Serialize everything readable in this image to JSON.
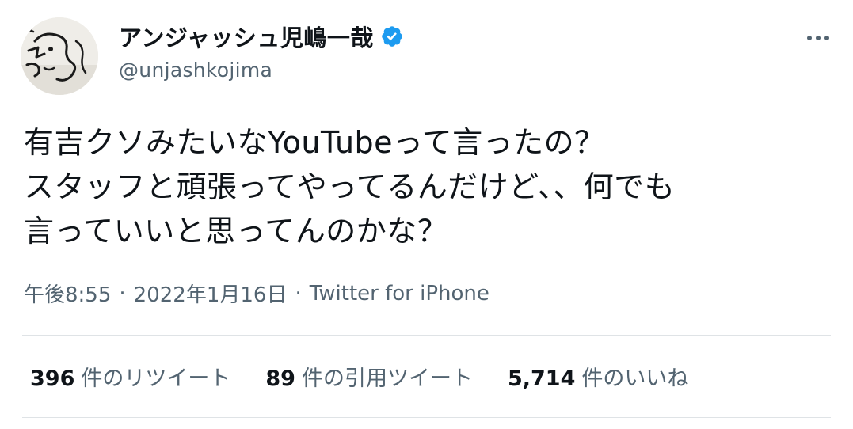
{
  "author": {
    "display_name": "アンジャッシュ児嶋一哉",
    "username": "@unjashkojima",
    "verified": true,
    "avatar_icon": "sketch-face-avatar"
  },
  "tweet": {
    "lines": [
      "有吉クソみたいなYouTubeって言ったの？",
      "スタッフと頑張ってやってるんだけど、、何でも",
      "言っていいと思ってんのかな？"
    ],
    "time": "午後8:55",
    "date": "2022年1月16日",
    "separator": "·",
    "source": "Twitter for iPhone"
  },
  "stats": {
    "retweets_count": "396",
    "retweets_label": "件のリツイート",
    "quotes_count": "89",
    "quotes_label": "件の引用ツイート",
    "likes_count": "5,714",
    "likes_label": "件のいいね"
  },
  "colors": {
    "text": "#0f1419",
    "secondary": "#536471",
    "verified": "#1d9bf0",
    "divider": "#dfe3e6"
  }
}
